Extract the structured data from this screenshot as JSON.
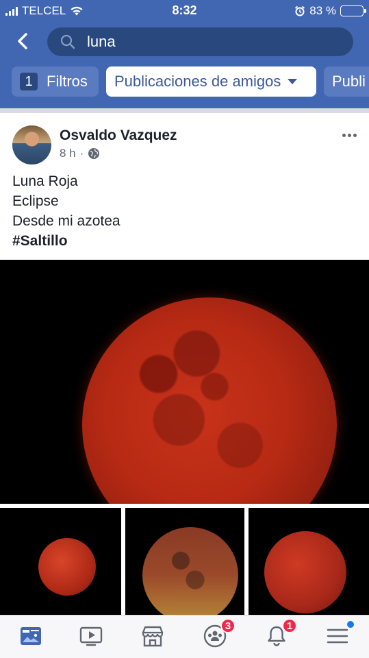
{
  "status_bar": {
    "carrier": "TELCEL",
    "time": "8:32",
    "battery_percent": "83 %",
    "battery_level": 0.83
  },
  "search": {
    "query": "luna"
  },
  "filters": {
    "count": "1",
    "filters_label": "Filtros",
    "selected_filter": "Publicaciones de amigos",
    "next_chip": "Publi"
  },
  "post": {
    "author": "Osvaldo Vazquez",
    "time": "8 h",
    "separator": "·",
    "privacy_icon": "globe-icon",
    "lines": [
      "Luna Roja",
      "Eclipse",
      "Desde mi azotea"
    ],
    "hashtag": "#Saltillo"
  },
  "tabbar": {
    "items": [
      {
        "name": "news-feed",
        "icon": "news-feed-icon",
        "active": true
      },
      {
        "name": "watch",
        "icon": "video-icon"
      },
      {
        "name": "marketplace",
        "icon": "store-icon"
      },
      {
        "name": "groups",
        "icon": "groups-icon",
        "badge": "3"
      },
      {
        "name": "notifications",
        "icon": "bell-icon",
        "badge": "1"
      },
      {
        "name": "menu",
        "icon": "menu-icon"
      }
    ]
  },
  "colors": {
    "brand": "#4267b2",
    "search_bg": "#29487d",
    "badge": "#f02849"
  }
}
